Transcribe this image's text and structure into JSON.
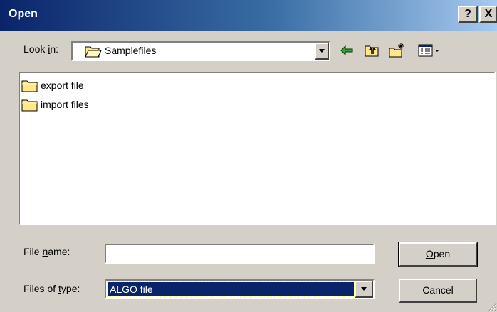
{
  "window": {
    "title": "Open",
    "help_label": "?",
    "close_label": "X"
  },
  "look_in": {
    "label_prefix": "Look ",
    "label_accel": "i",
    "label_suffix": "n:",
    "value": "Samplefiles"
  },
  "toolbar_icons": [
    "back-arrow-icon",
    "up-folder-icon",
    "new-folder-icon",
    "view-menu-icon"
  ],
  "files": [
    {
      "name": "export file",
      "icon": "folder-icon"
    },
    {
      "name": "import files",
      "icon": "folder-icon"
    }
  ],
  "file_name": {
    "label_prefix": "File ",
    "label_accel": "n",
    "label_suffix": "ame:",
    "value": ""
  },
  "files_of_type": {
    "label_prefix": "Files of ",
    "label_accel": "t",
    "label_suffix": "ype:",
    "value": "ALGO file"
  },
  "buttons": {
    "open_accel": "O",
    "open_rest": "pen",
    "cancel": "Cancel"
  },
  "colors": {
    "titlebar_start": "#0a246a",
    "titlebar_end": "#a6caf0",
    "dialog_bg": "#d4d0c8",
    "selection": "#0a246a",
    "folder_yellow": "#ffe88a"
  }
}
